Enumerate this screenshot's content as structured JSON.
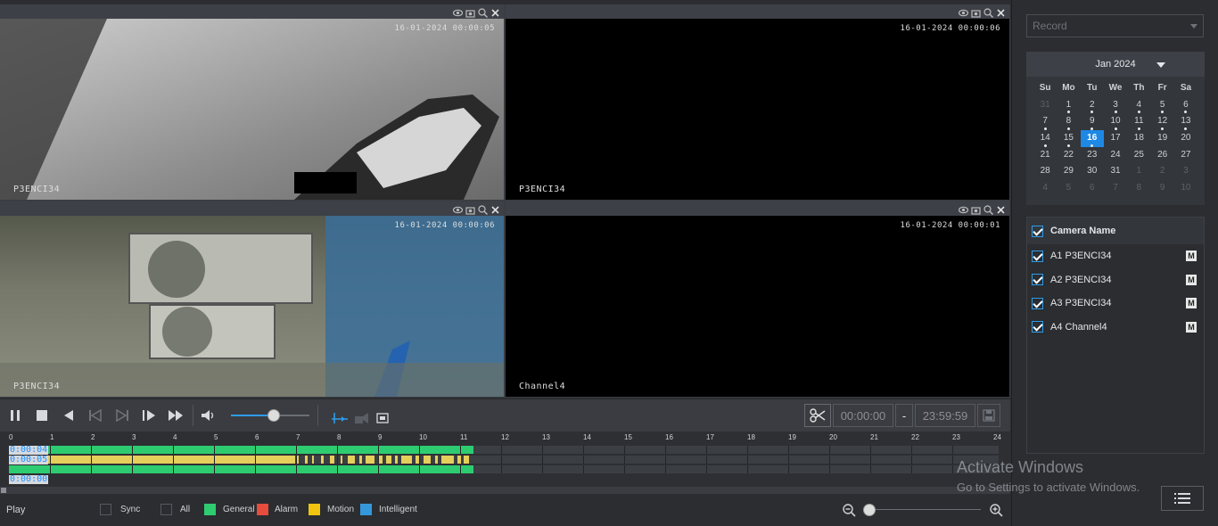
{
  "tiles": [
    {
      "timestamp": "16-01-2024 00:00:05",
      "camera": "P3ENCI34"
    },
    {
      "timestamp": "16-01-2024 00:00:06",
      "camera": "P3ENCI34"
    },
    {
      "timestamp": "16-01-2024 00:00:06",
      "camera": "P3ENCI34"
    },
    {
      "timestamp": "16-01-2024 00:00:01",
      "camera": "Channel4"
    }
  ],
  "clip": {
    "start": "00:00:00",
    "dash": "-",
    "end": "23:59:59"
  },
  "timeline": {
    "hours": [
      "0",
      "1",
      "2",
      "3",
      "4",
      "5",
      "6",
      "7",
      "8",
      "9",
      "10",
      "11",
      "12",
      "13",
      "14",
      "15",
      "16",
      "17",
      "18",
      "19",
      "20",
      "21",
      "22",
      "23",
      "24"
    ],
    "labels": [
      "0:00:04",
      "0:00:05",
      "0:00:00"
    ],
    "progress_hours": 11.2
  },
  "bottom": {
    "mode": "Play",
    "legend": [
      {
        "label": "Sync",
        "color": ""
      },
      {
        "label": "All",
        "color": ""
      },
      {
        "label": "General",
        "color": "#2ecc71"
      },
      {
        "label": "Alarm",
        "color": "#e74c3c"
      },
      {
        "label": "Motion",
        "color": "#f1c40f"
      },
      {
        "label": "Intelligent",
        "color": "#3498db"
      }
    ]
  },
  "record_select": {
    "value": "Record"
  },
  "calendar": {
    "month": "Jan 2024",
    "weekdays": [
      "Su",
      "Mo",
      "Tu",
      "We",
      "Th",
      "Fr",
      "Sa"
    ],
    "days": [
      "31",
      "1",
      "2",
      "3",
      "4",
      "5",
      "6",
      "7",
      "8",
      "9",
      "10",
      "11",
      "12",
      "13",
      "14",
      "15",
      "16",
      "17",
      "18",
      "19",
      "20",
      "21",
      "22",
      "23",
      "24",
      "25",
      "26",
      "27",
      "28",
      "29",
      "30",
      "31",
      "1",
      "2",
      "3",
      "4",
      "5",
      "6",
      "7",
      "8",
      "9",
      "10"
    ],
    "today": "16"
  },
  "cameras": {
    "header": "Camera Name",
    "items": [
      {
        "name": "A1 P3ENCI34",
        "m": "M"
      },
      {
        "name": "A2 P3ENCI34",
        "m": "M"
      },
      {
        "name": "A3 P3ENCI34",
        "m": "M"
      },
      {
        "name": "A4 Channel4",
        "m": "M"
      }
    ]
  },
  "watermark": {
    "title": "Activate Windows",
    "subtitle": "Go to Settings to activate Windows."
  },
  "colors": {
    "accent": "#2e9bea",
    "general": "#2ecc71",
    "motion": "#f1c40f",
    "selected_border": "#3ee04a"
  }
}
